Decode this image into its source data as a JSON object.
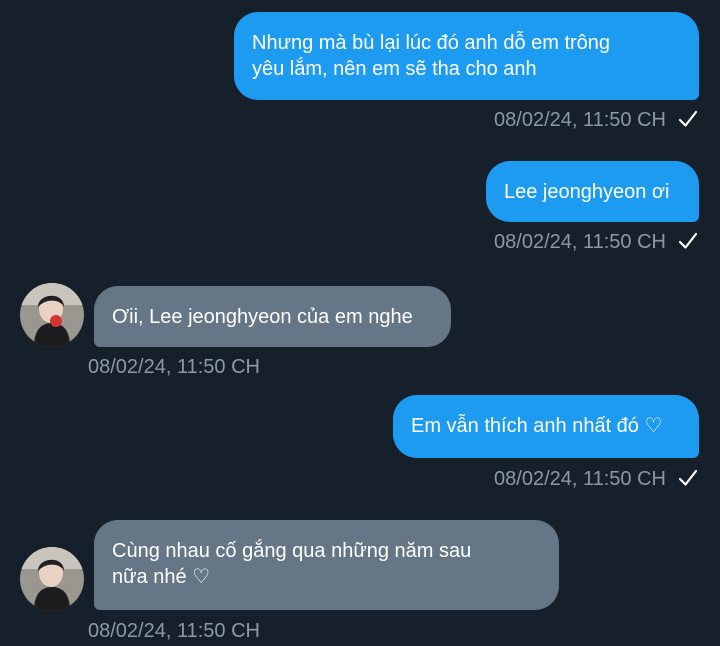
{
  "conversation": {
    "messages": [
      {
        "direction": "sent",
        "text": "Nhưng mà bù lại lúc đó anh dỗ em trông\nyêu lắm, nên em sẽ tha cho anh",
        "timestamp": "08/02/24, 11:50 CH",
        "status_icon": "checkmark-icon"
      },
      {
        "direction": "sent",
        "text": "Lee jeonghyeon ơi",
        "timestamp": "08/02/24, 11:50 CH",
        "status_icon": "checkmark-icon"
      },
      {
        "direction": "received",
        "text": "Ơii, Lee jeonghyeon của em nghe",
        "timestamp": "08/02/24, 11:50 CH",
        "avatar": "avatar"
      },
      {
        "direction": "sent",
        "text": "Em vẫn thích anh nhất đó ♡",
        "timestamp": "08/02/24, 11:50 CH",
        "status_icon": "checkmark-icon"
      },
      {
        "direction": "received",
        "text": "Cùng nhau cố gắng qua những năm sau\nnữa nhé ♡",
        "timestamp": "08/02/24, 11:50 CH",
        "avatar": "avatar"
      }
    ]
  },
  "colors": {
    "background": "#15202b",
    "sent_bubble": "#1d9bf0",
    "received_bubble": "#657786",
    "timestamp_text": "#8b98a5",
    "message_text": "#ffffff"
  }
}
